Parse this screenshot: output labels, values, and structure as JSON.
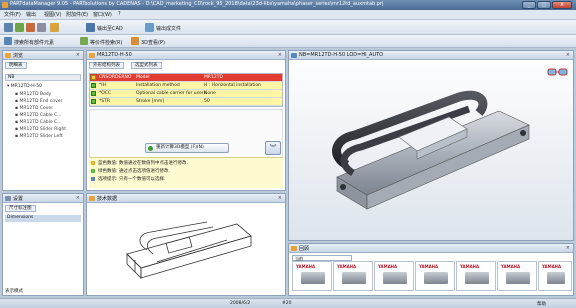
{
  "window": {
    "title": "PARTdataManager 9.05 - PARTsolutions by CADENAS - D:\\CAD_marketing_CD\\rock_95_2018\\data\\23d-libs\\yamaha\\phaser_series\\mr12td_auxmtab.prj",
    "min": "_",
    "max": "□",
    "close": "X"
  },
  "menu": [
    "文件(F)",
    "输出",
    "视图(V)",
    "附加件(E)",
    "窗口(W)",
    "?"
  ],
  "toolbar": {
    "export_cad": "输出至CAD",
    "export_table": "输出成文件"
  },
  "toolbar2": {
    "multi_search": "搜索所有部件元素",
    "equal_search": "等价件检索(R)",
    "view_3d": "3D查看(P)"
  },
  "left_panel": {
    "title": "浏览",
    "tab": "明细表",
    "header": "NB",
    "root": "MR12TD-H-50",
    "items": [
      "MR12TD Body",
      "MR12TD End cover",
      "MR12TD Cover",
      "MR12TD Cable C...",
      "MR12TD Cable C...",
      "MR12TD Slider Right",
      "MR12TD Slider Left"
    ]
  },
  "table_panel": {
    "title": "MR12TD-H-50",
    "tabs": [
      "外形结构列表",
      "选型式列表"
    ],
    "rows": [
      {
        "code": "CNSORDERNO",
        "desc": "Model",
        "value": "MR12TD"
      },
      {
        "code": "*IH",
        "desc": "Installation method",
        "value": "H : Horizontal installation"
      },
      {
        "code": "*OCC",
        "desc": "Optional cable carrier for users",
        "value": "None"
      },
      {
        "code": "*STR",
        "desc": "Stroke [mm]",
        "value": "50"
      }
    ],
    "recalc_button": "重新计算3D模型 (F)(N)",
    "messages": [
      "蓝色数值: 数值通过在数值列中点击进行修改.",
      "绿色数值: 通过点击选项值进行修改.",
      "选项提示: 只有一个数值可以选择."
    ]
  },
  "settings_panel": {
    "title": "设置",
    "tab": "尺寸标注图",
    "item": "Dimensions",
    "mode_label": "表示模式"
  },
  "tech_panel": {
    "title": "技术数据"
  },
  "viewer": {
    "title": "NB=MR12TD-H-50 LOD=HI_AUTO"
  },
  "preview_panel": {
    "title": "回顾",
    "select_value": "当前",
    "brand": "YAMAHA"
  },
  "status": {
    "date": "2008/6/2",
    "number": "#20",
    "mode": "帮助"
  }
}
